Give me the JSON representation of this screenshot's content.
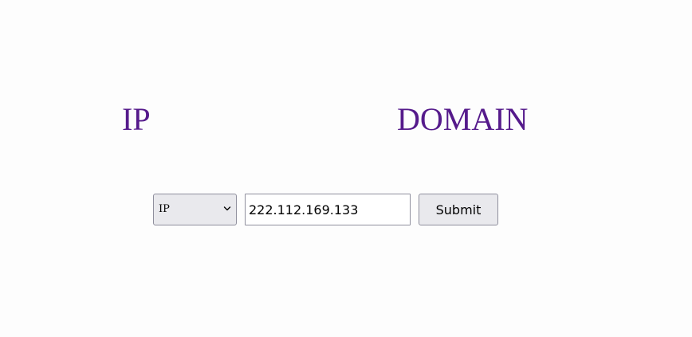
{
  "nav": {
    "ip_label": "IP",
    "domain_label": "DOMAIN",
    "link_color": "#551a8b"
  },
  "form": {
    "type_select": {
      "selected": "IP",
      "icon": "chevron-down-icon"
    },
    "ip_input": {
      "value": "222.112.169.133"
    },
    "submit_label": "Submit"
  }
}
